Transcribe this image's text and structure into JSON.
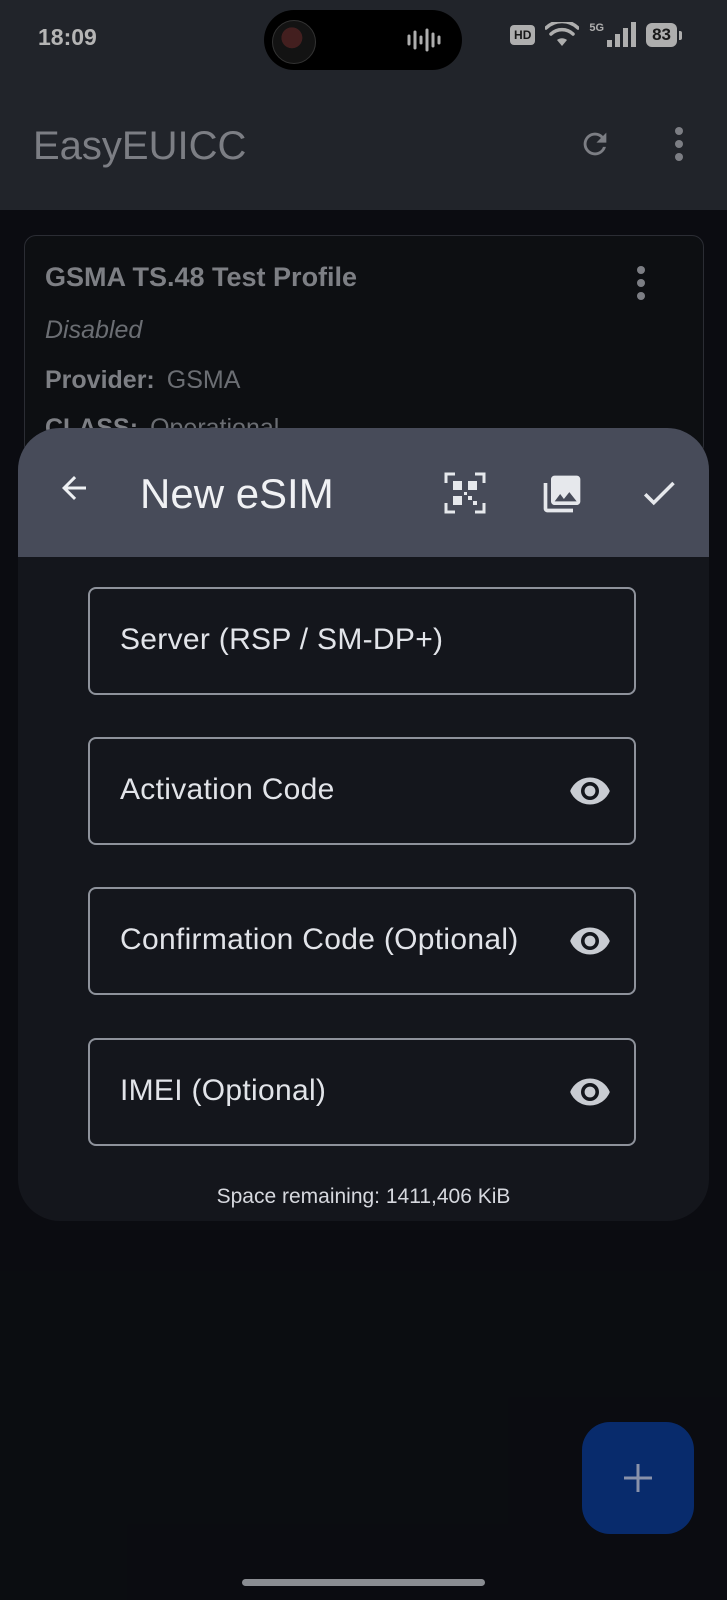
{
  "status_bar": {
    "time": "18:09",
    "hd_label": "HD",
    "network_label": "5G",
    "battery": "83"
  },
  "app_bar": {
    "title": "EasyEUICC",
    "refresh_icon": "refresh-icon",
    "overflow_icon": "more-vert-icon"
  },
  "profile_card": {
    "name": "GSMA TS.48 Test Profile",
    "state": "Disabled",
    "provider_label": "Provider:",
    "provider_value": "GSMA",
    "class_label": "CLASS:",
    "class_value": "Operational"
  },
  "dialog": {
    "title": "New eSIM",
    "fields": [
      {
        "label": "Server (RSP / SM-DP+)",
        "has_eye": false
      },
      {
        "label": "Activation Code",
        "has_eye": true
      },
      {
        "label": "Confirmation Code (Optional)",
        "has_eye": true
      },
      {
        "label": "IMEI (Optional)",
        "has_eye": true
      }
    ],
    "space_remaining": "Space remaining: 1411,406 KiB"
  },
  "fab": {
    "icon": "add-icon"
  },
  "colors": {
    "app_bar": "#2d3038",
    "dialog_bar": "#474b59",
    "dialog_bg": "#14161c",
    "fab": "#0b3a91",
    "page_bg": "#0f1117"
  }
}
